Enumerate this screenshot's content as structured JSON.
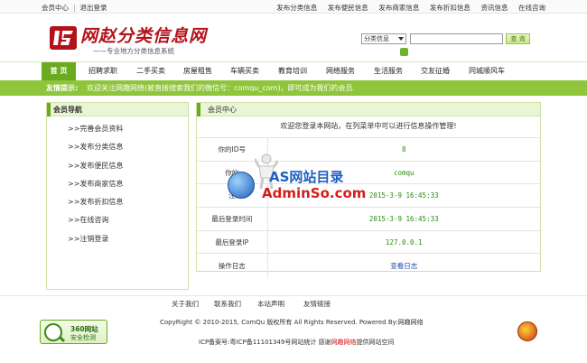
{
  "topbar": {
    "left": [
      "会员中心",
      "退出登录"
    ],
    "right": [
      "发布分类信息",
      "发布便民信息",
      "发布商家信息",
      "发布折扣信息",
      "资讯信息",
      "在线咨询"
    ]
  },
  "logo": {
    "name": "网赵分类信息网",
    "slogan": "——专业地方分类信息系统"
  },
  "search": {
    "category": "分类信息",
    "placeholder": "",
    "button": "查 询"
  },
  "nav": [
    "首 页",
    "招聘求职",
    "二手买卖",
    "房屋租售",
    "车辆买卖",
    "教育培训",
    "网络服务",
    "生活服务",
    "交友征婚",
    "同城顺风车"
  ],
  "notice": {
    "label": "友情提示:",
    "text": "欢迎关注网趣网络(被直接搜索我们的微信号：comqu_com)，即可成为我们的会员."
  },
  "sidebar": {
    "title": "会员导航",
    "items": [
      ">>完善会员资料",
      ">>发布分类信息",
      ">>发布便民信息",
      ">>发布商家信息",
      ">>发布折扣信息",
      ">>在线咨询",
      ">>注销登录"
    ]
  },
  "main": {
    "title": "会员中心",
    "welcome": "欢迎您登录本网站，在列菜单中可以进行信息操作管理!",
    "rows": [
      {
        "key": "你的ID号",
        "value": "8"
      },
      {
        "key": "你的",
        "value": "comqu"
      },
      {
        "key": "注",
        "value": "2015-3-9 16:45:33"
      },
      {
        "key": "最后登录时间",
        "value": "2015-3-9 16:45:33"
      },
      {
        "key": "最后登录IP",
        "value": "127.0.0.1"
      },
      {
        "key": "操作日志",
        "value": "查看日志"
      }
    ]
  },
  "watermark": {
    "line1": "AS网站目录",
    "line2": "AdminSo.com"
  },
  "footer": {
    "links": [
      "关于我们",
      "联系我们",
      "本站声明",
      "友情链接"
    ],
    "copyright": "CopyRight © 2010-2015, ComQu 版权所有 All Rights Reserved. Powered By:网趣网络",
    "icp_prefix": "ICP备案号:粤ICP备11101349号网站统计 感谢",
    "icp_red": "网趣网络",
    "icp_suffix": "提供网站空间",
    "badge_line1": "360网站",
    "badge_line2": "安全检测"
  },
  "colors": {
    "brand_green": "#6aaa1e",
    "notice_green": "#8ec53b",
    "logo_red": "#b4121a",
    "value_green": "#2e8b16",
    "link_blue": "#1f4ea8"
  }
}
